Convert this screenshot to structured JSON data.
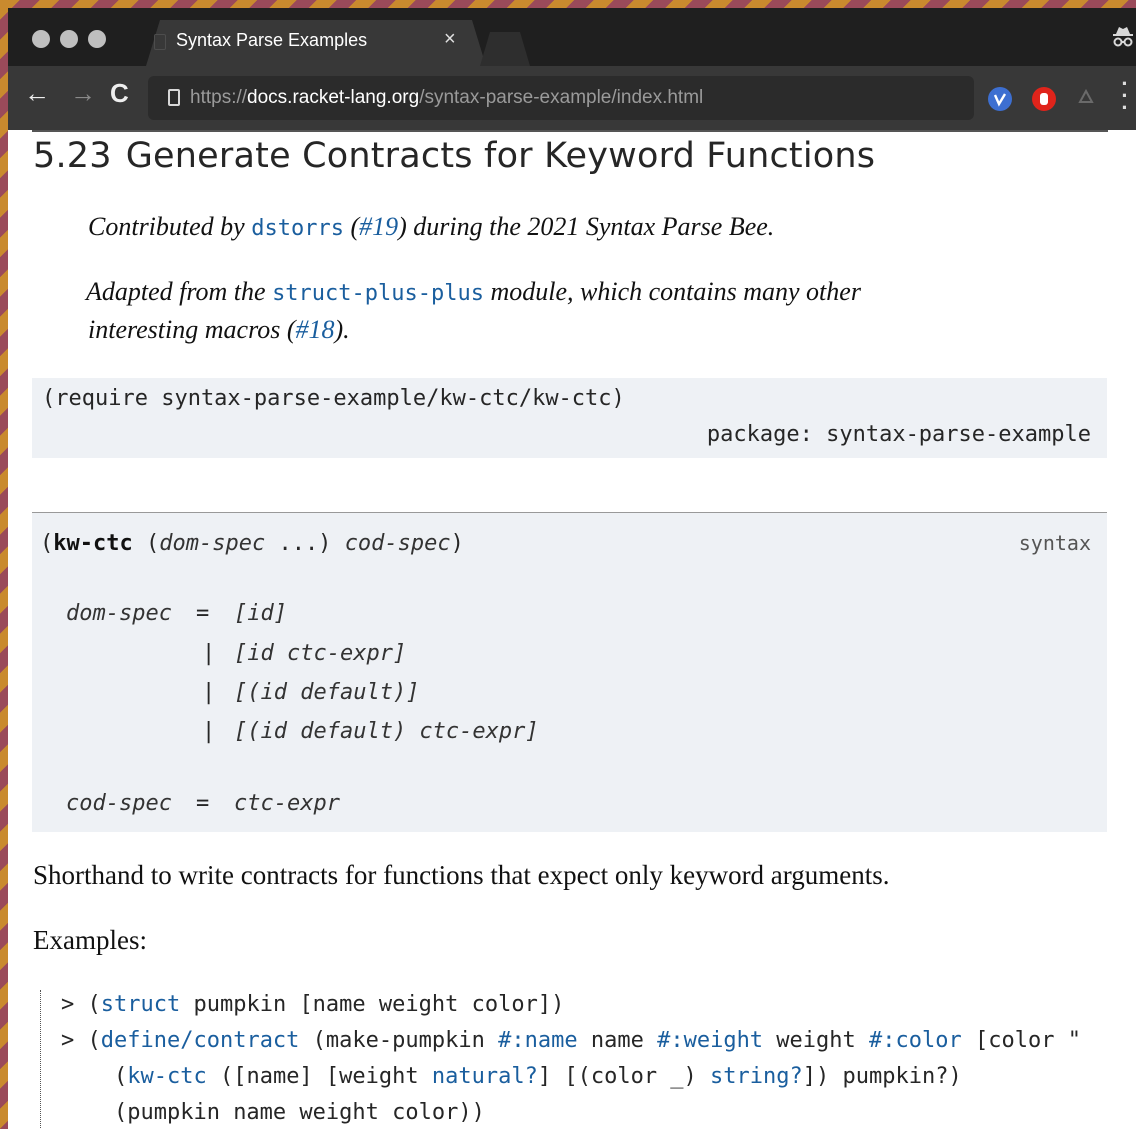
{
  "browser": {
    "tab_title": "Syntax Parse Examples",
    "tab_close": "×",
    "url_scheme": "https://",
    "url_host": "docs.racket-lang.org",
    "url_path": "/syntax-parse-example/index.html",
    "nav_back": "←",
    "nav_forward": "→",
    "nav_reload": "C",
    "incognito_icon": "incognito-icon",
    "extensions": [
      "vpn-extension-icon",
      "adblock-extension-icon",
      "recycle-extension-icon"
    ],
    "accent_colors": {
      "vpn": "#3d6fd1",
      "adblock": "#e0241b"
    }
  },
  "page": {
    "section_number": "5.23",
    "section_title": "Generate Contracts for Keyword Functions",
    "contrib": {
      "prefix": "Contributed by ",
      "author": "dstorrs",
      "paren_open": " (",
      "issue": "#19",
      "suffix": ") during the 2021 Syntax Parse Bee."
    },
    "adapted": {
      "prefix": "Adapted from the ",
      "module": "struct-plus-plus",
      "suffix": " module, which contains many other",
      "line2_prefix": "interesting macros (",
      "issue": "#18",
      "line2_suffix": ")."
    },
    "require": {
      "form": "(require syntax-parse-example/kw-ctc/kw-ctc)",
      "package_label": "package:",
      "package_name": "syntax-parse-example"
    },
    "syntax_def": {
      "open": "(",
      "name": "kw-ctc",
      "rest_1": " (",
      "dom_spec": "dom-spec",
      "ellipsis": " ...) ",
      "cod_spec": "cod-spec",
      "close": ")",
      "kind": "syntax",
      "grammar": [
        {
          "lhs": "dom-spec",
          "eq": "=",
          "rhs": "[id]"
        },
        {
          "bar": "|",
          "rhs": "[id ctc-expr]"
        },
        {
          "bar": "|",
          "rhs": "[(id default)]"
        },
        {
          "bar": "|",
          "rhs": "[(id default) ctc-expr]"
        },
        {
          "lhs": "cod-spec",
          "eq": "=",
          "rhs": "ctc-expr"
        }
      ]
    },
    "description": "Shorthand to write contracts for functions that expect only keyword arguments.",
    "examples_label": "Examples:",
    "examples": [
      {
        "prompt": "> ",
        "open": "(",
        "kw": "struct",
        "rest": " pumpkin [name weight color])"
      },
      {
        "prompt": "> ",
        "open": "(",
        "kw": "define/contract",
        "rest": " (make-pumpkin ",
        "kw2": "#:name",
        "rest2": " name ",
        "kw3": "#:weight",
        "rest3": " weight ",
        "kw4": "#:color",
        "rest4": " [color \""
      },
      {
        "indent": "    ",
        "open": "(",
        "kw": "kw-ctc",
        "rest": " ([name] [weight ",
        "kw2": "natural?",
        "rest2": "] [(color _) ",
        "kw3": "string?",
        "rest3": "]) pumpkin?)"
      },
      {
        "indent": "    ",
        "text": "(pumpkin name weight color))"
      }
    ]
  }
}
